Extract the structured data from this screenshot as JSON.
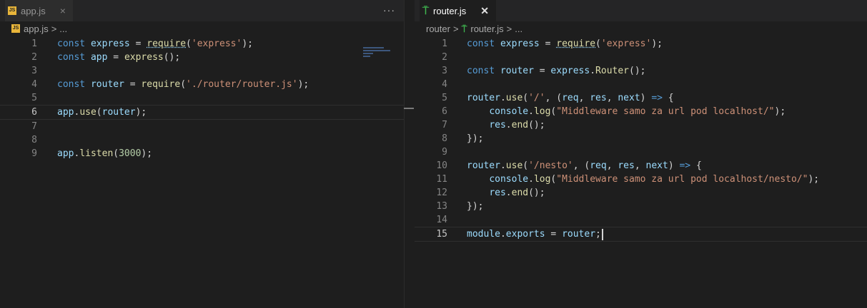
{
  "left": {
    "tab": {
      "icon": "js-file-icon",
      "name": "app.js",
      "close": "×"
    },
    "more_label": "···",
    "breadcrumb": {
      "file": "app.js",
      "sep": ">",
      "tail": "..."
    },
    "lines": [
      {
        "n": "1",
        "tokens": [
          {
            "t": "const ",
            "c": "kw"
          },
          {
            "t": "express",
            "c": "var"
          },
          {
            "t": " = ",
            "c": "pun"
          },
          {
            "t": "require",
            "c": "req"
          },
          {
            "t": "(",
            "c": "pun"
          },
          {
            "t": "'express'",
            "c": "str"
          },
          {
            "t": ");",
            "c": "pun"
          }
        ]
      },
      {
        "n": "2",
        "tokens": [
          {
            "t": "const ",
            "c": "kw"
          },
          {
            "t": "app",
            "c": "var"
          },
          {
            "t": " = ",
            "c": "pun"
          },
          {
            "t": "express",
            "c": "fn"
          },
          {
            "t": "();",
            "c": "pun"
          }
        ]
      },
      {
        "n": "3",
        "tokens": []
      },
      {
        "n": "4",
        "tokens": [
          {
            "t": "const ",
            "c": "kw"
          },
          {
            "t": "router",
            "c": "var"
          },
          {
            "t": " = ",
            "c": "pun"
          },
          {
            "t": "require",
            "c": "fn"
          },
          {
            "t": "(",
            "c": "pun"
          },
          {
            "t": "'./router/router.js'",
            "c": "str"
          },
          {
            "t": ");",
            "c": "pun"
          }
        ]
      },
      {
        "n": "5",
        "tokens": []
      },
      {
        "n": "6",
        "tokens": [
          {
            "t": "app",
            "c": "var"
          },
          {
            "t": ".",
            "c": "pun"
          },
          {
            "t": "use",
            "c": "fn"
          },
          {
            "t": "(",
            "c": "pun"
          },
          {
            "t": "router",
            "c": "var"
          },
          {
            "t": ");",
            "c": "pun"
          }
        ],
        "current": true
      },
      {
        "n": "7",
        "tokens": []
      },
      {
        "n": "8",
        "tokens": []
      },
      {
        "n": "9",
        "tokens": [
          {
            "t": "app",
            "c": "var"
          },
          {
            "t": ".",
            "c": "pun"
          },
          {
            "t": "listen",
            "c": "fn"
          },
          {
            "t": "(",
            "c": "pun"
          },
          {
            "t": "3000",
            "c": "num"
          },
          {
            "t": ");",
            "c": "pun"
          }
        ]
      }
    ]
  },
  "right": {
    "tab": {
      "icon": "router-icon",
      "name": "router.js",
      "close": "✕"
    },
    "breadcrumb": {
      "folder": "router",
      "file": "router.js",
      "sep": ">",
      "tail": "..."
    },
    "lines": [
      {
        "n": "1",
        "tokens": [
          {
            "t": "const ",
            "c": "kw"
          },
          {
            "t": "express",
            "c": "var"
          },
          {
            "t": " = ",
            "c": "pun"
          },
          {
            "t": "require",
            "c": "req"
          },
          {
            "t": "(",
            "c": "pun"
          },
          {
            "t": "'express'",
            "c": "str"
          },
          {
            "t": ");",
            "c": "pun"
          }
        ]
      },
      {
        "n": "2",
        "tokens": []
      },
      {
        "n": "3",
        "tokens": [
          {
            "t": "const ",
            "c": "kw"
          },
          {
            "t": "router",
            "c": "var"
          },
          {
            "t": " = ",
            "c": "pun"
          },
          {
            "t": "express",
            "c": "var"
          },
          {
            "t": ".",
            "c": "pun"
          },
          {
            "t": "Router",
            "c": "fn"
          },
          {
            "t": "();",
            "c": "pun"
          }
        ]
      },
      {
        "n": "4",
        "tokens": []
      },
      {
        "n": "5",
        "tokens": [
          {
            "t": "router",
            "c": "var"
          },
          {
            "t": ".",
            "c": "pun"
          },
          {
            "t": "use",
            "c": "fn"
          },
          {
            "t": "(",
            "c": "pun"
          },
          {
            "t": "'/'",
            "c": "str"
          },
          {
            "t": ", (",
            "c": "pun"
          },
          {
            "t": "req",
            "c": "var"
          },
          {
            "t": ", ",
            "c": "pun"
          },
          {
            "t": "res",
            "c": "var"
          },
          {
            "t": ", ",
            "c": "pun"
          },
          {
            "t": "next",
            "c": "var"
          },
          {
            "t": ") ",
            "c": "pun"
          },
          {
            "t": "=>",
            "c": "arrow"
          },
          {
            "t": " {",
            "c": "pun"
          }
        ]
      },
      {
        "n": "6",
        "tokens": [
          {
            "t": "    ",
            "c": "pun"
          },
          {
            "t": "console",
            "c": "var"
          },
          {
            "t": ".",
            "c": "pun"
          },
          {
            "t": "log",
            "c": "fn"
          },
          {
            "t": "(",
            "c": "pun"
          },
          {
            "t": "\"Middleware samo za url pod localhost/\"",
            "c": "str"
          },
          {
            "t": ");",
            "c": "pun"
          }
        ]
      },
      {
        "n": "7",
        "tokens": [
          {
            "t": "    ",
            "c": "pun"
          },
          {
            "t": "res",
            "c": "var"
          },
          {
            "t": ".",
            "c": "pun"
          },
          {
            "t": "end",
            "c": "fn"
          },
          {
            "t": "();",
            "c": "pun"
          }
        ]
      },
      {
        "n": "8",
        "tokens": [
          {
            "t": "});",
            "c": "pun"
          }
        ]
      },
      {
        "n": "9",
        "tokens": []
      },
      {
        "n": "10",
        "tokens": [
          {
            "t": "router",
            "c": "var"
          },
          {
            "t": ".",
            "c": "pun"
          },
          {
            "t": "use",
            "c": "fn"
          },
          {
            "t": "(",
            "c": "pun"
          },
          {
            "t": "'/nesto'",
            "c": "str"
          },
          {
            "t": ", (",
            "c": "pun"
          },
          {
            "t": "req",
            "c": "var"
          },
          {
            "t": ", ",
            "c": "pun"
          },
          {
            "t": "res",
            "c": "var"
          },
          {
            "t": ", ",
            "c": "pun"
          },
          {
            "t": "next",
            "c": "var"
          },
          {
            "t": ") ",
            "c": "pun"
          },
          {
            "t": "=>",
            "c": "arrow"
          },
          {
            "t": " {",
            "c": "pun"
          }
        ]
      },
      {
        "n": "11",
        "tokens": [
          {
            "t": "    ",
            "c": "pun"
          },
          {
            "t": "console",
            "c": "var"
          },
          {
            "t": ".",
            "c": "pun"
          },
          {
            "t": "log",
            "c": "fn"
          },
          {
            "t": "(",
            "c": "pun"
          },
          {
            "t": "\"Middleware samo za url pod localhost/nesto/\"",
            "c": "str"
          },
          {
            "t": ");",
            "c": "pun"
          }
        ]
      },
      {
        "n": "12",
        "tokens": [
          {
            "t": "    ",
            "c": "pun"
          },
          {
            "t": "res",
            "c": "var"
          },
          {
            "t": ".",
            "c": "pun"
          },
          {
            "t": "end",
            "c": "fn"
          },
          {
            "t": "();",
            "c": "pun"
          }
        ]
      },
      {
        "n": "13",
        "tokens": [
          {
            "t": "});",
            "c": "pun"
          }
        ]
      },
      {
        "n": "14",
        "tokens": []
      },
      {
        "n": "15",
        "tokens": [
          {
            "t": "module",
            "c": "var"
          },
          {
            "t": ".",
            "c": "pun"
          },
          {
            "t": "exports",
            "c": "var"
          },
          {
            "t": " = ",
            "c": "pun"
          },
          {
            "t": "router",
            "c": "var"
          },
          {
            "t": ";",
            "c": "pun"
          }
        ],
        "current": true,
        "cursor": true
      }
    ]
  },
  "colors": {
    "editor_bg": "#1e1e1e",
    "tabbar_bg": "#252526",
    "js_icon": "#e8b53a",
    "router_icon": "#3fb950"
  }
}
